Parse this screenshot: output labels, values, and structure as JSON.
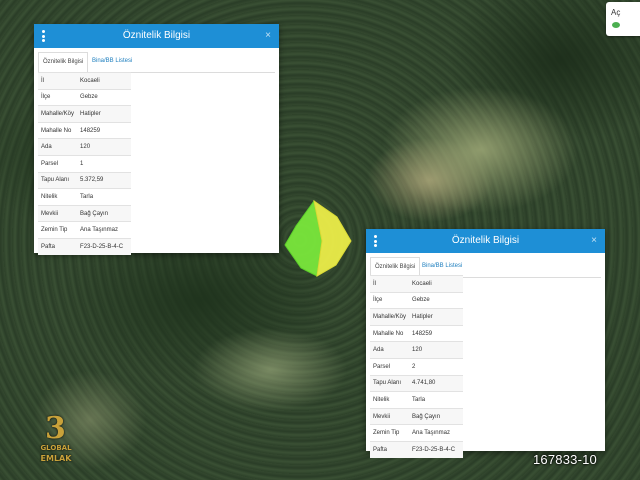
{
  "corner_widget": {
    "label": "Aç",
    "indicator_color": "#4caf50"
  },
  "panel_1": {
    "title": "Öznitelik Bilgisi",
    "close": "×",
    "tabs": [
      {
        "label": "Öznitelik Bilgisi",
        "active": true
      },
      {
        "label": "Bina/BB Listesi",
        "active": false
      }
    ],
    "rows": [
      {
        "key": "İl",
        "value": "Kocaeli"
      },
      {
        "key": "İlçe",
        "value": "Gebze"
      },
      {
        "key": "Mahalle/Köy",
        "value": "Hatipler"
      },
      {
        "key": "Mahalle No",
        "value": "148259"
      },
      {
        "key": "Ada",
        "value": "120"
      },
      {
        "key": "Parsel",
        "value": "1"
      },
      {
        "key": "Tapu Alanı",
        "value": "5.372,59"
      },
      {
        "key": "Nitelik",
        "value": "Tarla"
      },
      {
        "key": "Mevkii",
        "value": "Bağ Çayın"
      },
      {
        "key": "Zemin Tip",
        "value": "Ana Taşınmaz"
      },
      {
        "key": "Pafta",
        "value": "F23-D-25-B-4-C"
      }
    ]
  },
  "panel_2": {
    "title": "Öznitelik Bilgisi",
    "close": "×",
    "tabs": [
      {
        "label": "Öznitelik Bilgisi",
        "active": true
      },
      {
        "label": "Bina/BB Listesi",
        "active": false
      }
    ],
    "rows": [
      {
        "key": "İl",
        "value": "Kocaeli"
      },
      {
        "key": "İlçe",
        "value": "Gebze"
      },
      {
        "key": "Mahalle/Köy",
        "value": "Hatipler"
      },
      {
        "key": "Mahalle No",
        "value": "148259"
      },
      {
        "key": "Ada",
        "value": "120"
      },
      {
        "key": "Parsel",
        "value": "2"
      },
      {
        "key": "Tapu Alanı",
        "value": "4.741,80"
      },
      {
        "key": "Nitelik",
        "value": "Tarla"
      },
      {
        "key": "Mevkii",
        "value": "Bağ Çayın"
      },
      {
        "key": "Zemin Tip",
        "value": "Ana Taşınmaz"
      },
      {
        "key": "Pafta",
        "value": "F23-D-25-B-4-C"
      }
    ]
  },
  "parcels": [
    {
      "id": "parcel-1",
      "color": "#7cec3c"
    },
    {
      "id": "parcel-2",
      "color": "#f1f24a"
    }
  ],
  "watermark": {
    "number": "3",
    "line1": "GLOBAL",
    "line2": "EMLAK",
    "color": "#c9a23a"
  },
  "listing_id": "167833-10",
  "colors": {
    "header_blue": "#1e8fd6",
    "tab_link": "#1e7fbf"
  }
}
